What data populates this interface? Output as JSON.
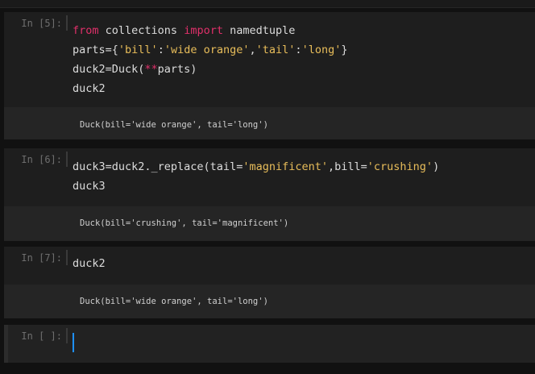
{
  "cells": [
    {
      "prompt": "In [5]:",
      "code_lines": [
        {
          "tokens": [
            {
              "t": "from",
              "k": "kw"
            },
            {
              "t": " collections ",
              "k": "op"
            },
            {
              "t": "import",
              "k": "kw"
            },
            {
              "t": " namedtuple",
              "k": "op"
            }
          ]
        },
        {
          "tokens": [
            {
              "t": "parts={",
              "k": "op"
            },
            {
              "t": "'bill'",
              "k": "str"
            },
            {
              "t": ":",
              "k": "op"
            },
            {
              "t": "'wide orange'",
              "k": "str"
            },
            {
              "t": ",",
              "k": "op"
            },
            {
              "t": "'tail'",
              "k": "str"
            },
            {
              "t": ":",
              "k": "op"
            },
            {
              "t": "'long'",
              "k": "str"
            },
            {
              "t": "}",
              "k": "op"
            }
          ]
        },
        {
          "tokens": [
            {
              "t": "duck2=Duck(",
              "k": "op"
            },
            {
              "t": "**",
              "k": "kw"
            },
            {
              "t": "parts)",
              "k": "op"
            }
          ]
        },
        {
          "tokens": [
            {
              "t": "duck2",
              "k": "op"
            }
          ]
        }
      ],
      "output": "Duck(bill='wide orange', tail='long')"
    },
    {
      "prompt": "In [6]:",
      "code_lines": [
        {
          "tokens": [
            {
              "t": "duck3=duck2._replace(tail=",
              "k": "op"
            },
            {
              "t": "'magnificent'",
              "k": "str"
            },
            {
              "t": ",bill=",
              "k": "op"
            },
            {
              "t": "'crushing'",
              "k": "str"
            },
            {
              "t": ")",
              "k": "op"
            }
          ]
        },
        {
          "tokens": [
            {
              "t": "duck3",
              "k": "op"
            }
          ]
        }
      ],
      "output": "Duck(bill='crushing', tail='magnificent')"
    },
    {
      "prompt": "In [7]:",
      "code_lines": [
        {
          "tokens": [
            {
              "t": "duck2",
              "k": "op"
            }
          ]
        }
      ],
      "output": "Duck(bill='wide orange', tail='long')"
    },
    {
      "prompt": "In [ ]:",
      "code_lines": [],
      "output": null
    }
  ],
  "colors": {
    "keyword": "#e0306a",
    "string": "#e8bd5a",
    "text": "#dcdcdc",
    "cursor": "#1e90ff"
  }
}
